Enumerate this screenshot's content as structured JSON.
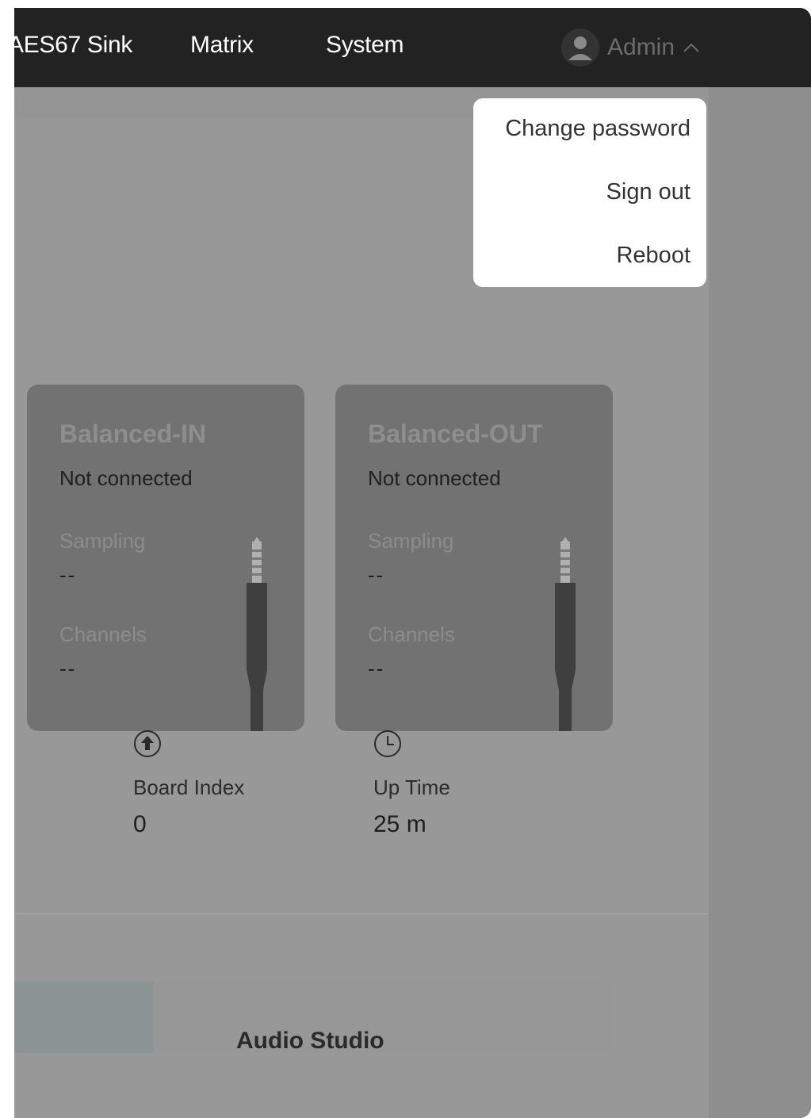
{
  "navbar": {
    "items": [
      {
        "label": "AES67 Sink"
      },
      {
        "label": "Matrix"
      },
      {
        "label": "System"
      }
    ],
    "user": {
      "name": "Admin",
      "icon": "user-avatar-icon",
      "chevron_icon": "chevron-up-icon"
    }
  },
  "user_dropdown": {
    "items": [
      {
        "label": "Change password"
      },
      {
        "label": "Sign out"
      },
      {
        "label": "Reboot"
      }
    ]
  },
  "ports": [
    {
      "title": "Balanced-IN",
      "status": "Not connected",
      "sampling_label": "Sampling",
      "sampling_value": "--",
      "channels_label": "Channels",
      "channels_value": "--",
      "icon": "audio-jack-icon"
    },
    {
      "title": "Balanced-OUT",
      "status": "Not connected",
      "sampling_label": "Sampling",
      "sampling_value": "--",
      "channels_label": "Channels",
      "channels_value": "--",
      "icon": "audio-jack-icon"
    }
  ],
  "stats": [
    {
      "label": "Board Index",
      "value": "0",
      "icon": "arrow-up-circle-icon"
    },
    {
      "label": "Up Time",
      "value": "25 m",
      "icon": "clock-icon"
    }
  ],
  "bottom_panel": {
    "title": "Audio Studio"
  },
  "colors": {
    "navbar_bg": "#222222",
    "overlay": "#989898",
    "card_bg": "#727272",
    "dropdown_bg": "#ffffff"
  }
}
